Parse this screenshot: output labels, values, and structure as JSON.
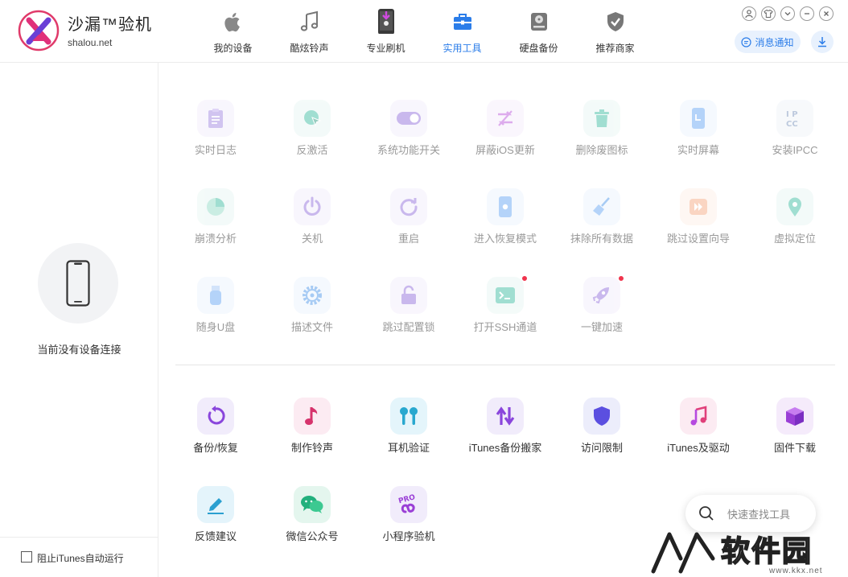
{
  "brand": {
    "title": "沙漏™验机",
    "subtitle": "shalou.net"
  },
  "nav": [
    {
      "id": "my-device",
      "label": "我的设备",
      "icon": "apple-icon"
    },
    {
      "id": "ringtones",
      "label": "酷炫铃声",
      "icon": "music-note-icon"
    },
    {
      "id": "pro-flash",
      "label": "专业刷机",
      "icon": "phone-flash-icon"
    },
    {
      "id": "tools",
      "label": "实用工具",
      "icon": "toolbox-icon",
      "active": true
    },
    {
      "id": "disk-backup",
      "label": "硬盘备份",
      "icon": "hard-disk-icon"
    },
    {
      "id": "recommended",
      "label": "推荐商家",
      "icon": "shield-check-icon"
    }
  ],
  "header": {
    "message_label": "消息通知"
  },
  "sidebar": {
    "no_device_text": "当前没有设备连接",
    "itunes_checkbox_label": "阻止iTunes自动运行"
  },
  "tools_disabled": [
    {
      "label": "实时日志",
      "icon": "clipboard-log-icon"
    },
    {
      "label": "反激活",
      "icon": "deactivate-cursor-icon"
    },
    {
      "label": "系统功能开关",
      "icon": "toggle-switch-icon"
    },
    {
      "label": "屏蔽iOS更新",
      "icon": "block-update-icon"
    },
    {
      "label": "删除废图标",
      "icon": "trash-icon"
    },
    {
      "label": "实时屏幕",
      "icon": "live-screen-icon"
    },
    {
      "label": "安装IPCC",
      "icon": "ipcc-icon"
    },
    {
      "label": "崩溃分析",
      "icon": "pie-chart-icon"
    },
    {
      "label": "关机",
      "icon": "power-icon"
    },
    {
      "label": "重启",
      "icon": "restart-icon"
    },
    {
      "label": "进入恢复模式",
      "icon": "recovery-mode-icon"
    },
    {
      "label": "抹除所有数据",
      "icon": "broom-icon"
    },
    {
      "label": "跳过设置向导",
      "icon": "skip-forward-icon"
    },
    {
      "label": "虚拟定位",
      "icon": "location-pin-icon"
    },
    {
      "label": "随身U盘",
      "icon": "usb-drive-icon"
    },
    {
      "label": "描述文件",
      "icon": "gear-profile-icon"
    },
    {
      "label": "跳过配置锁",
      "icon": "unlock-icon"
    },
    {
      "label": "打开SSH通道",
      "icon": "terminal-icon",
      "badge": true
    },
    {
      "label": "一键加速",
      "icon": "rocket-icon",
      "badge": true
    }
  ],
  "tools_enabled": [
    {
      "label": "备份/恢复",
      "icon": "backup-restore-icon"
    },
    {
      "label": "制作铃声",
      "icon": "ringtone-note-icon"
    },
    {
      "label": "耳机验证",
      "icon": "earbuds-icon"
    },
    {
      "label": "iTunes备份搬家",
      "icon": "transfer-arrows-icon"
    },
    {
      "label": "访问限制",
      "icon": "shield-icon"
    },
    {
      "label": "iTunes及驱动",
      "icon": "itunes-note-icon"
    },
    {
      "label": "固件下载",
      "icon": "firmware-box-icon"
    },
    {
      "label": "反馈建议",
      "icon": "feedback-edit-icon"
    },
    {
      "label": "微信公众号",
      "icon": "wechat-icon"
    },
    {
      "label": "小程序验机",
      "icon": "mini-program-icon"
    }
  ],
  "search": {
    "placeholder": "快速查找工具"
  },
  "watermark": {
    "text": "软件园",
    "url": "www.kkx.net"
  },
  "colors": {
    "accent": "#2b7de9",
    "badge": "#f0344d",
    "disabled_text": "#9a9a9a"
  }
}
